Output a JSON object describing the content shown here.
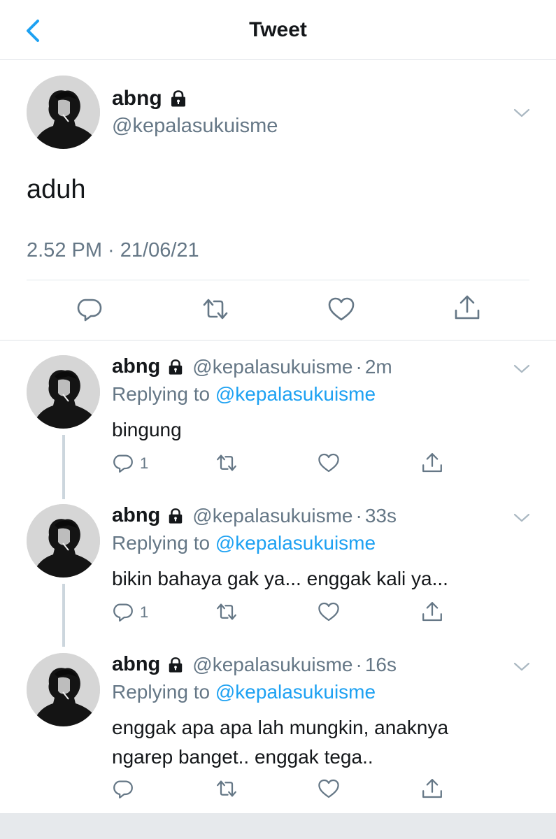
{
  "header": {
    "title": "Tweet",
    "back_icon": "chevron-left-icon",
    "accent": "#1da1f2"
  },
  "main_tweet": {
    "name": "abng",
    "handle": "@kepalasukuisme",
    "text": "aduh",
    "timestamp": "2.52 PM · 21/06/21",
    "locked": true
  },
  "replies": [
    {
      "name": "abng",
      "handle": "@kepalasukuisme",
      "time": "2m",
      "replying_label": "Replying to",
      "replying_to": "@kepalasukuisme",
      "text": "bingung",
      "reply_count": "1"
    },
    {
      "name": "abng",
      "handle": "@kepalasukuisme",
      "time": "33s",
      "replying_label": "Replying to",
      "replying_to": "@kepalasukuisme",
      "text": "bikin bahaya gak ya... enggak kali ya...",
      "reply_count": "1"
    },
    {
      "name": "abng",
      "handle": "@kepalasukuisme",
      "time": "16s",
      "replying_label": "Replying to",
      "replying_to": "@kepalasukuisme",
      "text_line1": "enggak apa apa lah mungkin, anaknya",
      "text_line2": "ngarep banget.. enggak tega..",
      "reply_count": ""
    }
  ],
  "separator": "·",
  "colors": {
    "text": "#14171a",
    "secondary": "#657786",
    "link": "#1da1f2",
    "divider": "#e1e8ed",
    "thread_line": "#ccd6dd"
  }
}
